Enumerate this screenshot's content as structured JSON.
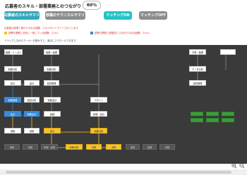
{
  "header": {
    "title": "応募者のスキル・部署業務とのつながり",
    "match_rate": "60%"
  },
  "tabs": [
    {
      "label": "応募者のスキルサマリー",
      "state": "active"
    },
    {
      "label": "部署のテクニカルサマリー",
      "state": "inactive"
    },
    {
      "label": "マッチングON",
      "state": "teal"
    },
    {
      "label": "マッチングOFF",
      "state": "inactive"
    }
  ],
  "legend": {
    "title": "応募者の経歴と関わりのある経験・スキルがハイライトされています",
    "items": [
      {
        "label": "部署の業務と完全に一致している経験・スキル",
        "color": "#f4c233"
      },
      {
        "label": "部署の業務と間接的につながりのある経験・スキル",
        "color": "#3a8bd8"
      }
    ]
  },
  "hint": "ドラッグしながらマーカーを動かすと、宝法にスクロールできます",
  "colors": {
    "accent": "#32a8bd",
    "match_on": "#21c4c6",
    "exact_match": "#f4c233",
    "indirect_match": "#3a8bd8",
    "canvas_bg": "#3a3a3a"
  },
  "graph": {
    "nodes": [
      {
        "id": "n1",
        "label": "経理・リーガル",
        "style": "white"
      },
      {
        "id": "n2",
        "label": "財務・経理",
        "style": "white"
      },
      {
        "id": "n3",
        "label": "財務分析",
        "style": "white"
      },
      {
        "id": "n4",
        "label": "財務分析",
        "style": "white"
      },
      {
        "id": "n5",
        "label": "予算・管理",
        "style": "white"
      },
      {
        "id": "n6",
        "label": "データ分析",
        "style": "white"
      },
      {
        "id": "n7",
        "label": "会計",
        "style": "white"
      },
      {
        "id": "n8",
        "label": "会計",
        "style": "white"
      },
      {
        "id": "n9",
        "label": "経営管理",
        "style": "white"
      },
      {
        "id": "n10",
        "label": "経営管理",
        "style": "white"
      },
      {
        "id": "n11",
        "label": "財務管理",
        "style": "blue"
      },
      {
        "id": "n12",
        "label": "会計",
        "style": "blue"
      },
      {
        "id": "n13",
        "label": "財務会計",
        "style": "blue"
      },
      {
        "id": "n14",
        "label": "経営分析",
        "style": "white"
      },
      {
        "id": "n15",
        "label": "デザイン",
        "style": "white"
      },
      {
        "id": "n16",
        "label": "財務会計",
        "style": "white"
      },
      {
        "id": "n17",
        "label": "経理",
        "style": "white"
      },
      {
        "id": "n18",
        "label": "財務・会計",
        "style": "white"
      },
      {
        "id": "n19",
        "label": "業務",
        "style": "white"
      },
      {
        "id": "n20",
        "label": "税務",
        "style": "white"
      },
      {
        "id": "n21",
        "label": "会計",
        "style": "yellow"
      },
      {
        "id": "n22",
        "label": "財務分析",
        "style": "yellow"
      },
      {
        "id": "n23",
        "label": "財務分析",
        "style": "yellow"
      },
      {
        "id": "n24",
        "label": "財務",
        "style": "yellow"
      },
      {
        "id": "n25",
        "label": "財務",
        "style": "dark"
      },
      {
        "id": "n26",
        "label": "財務",
        "style": "dark"
      },
      {
        "id": "n27",
        "label": "財務・経理",
        "style": "dark"
      },
      {
        "id": "n28",
        "label": "財務",
        "style": "dark"
      },
      {
        "id": "n29",
        "label": "決算",
        "style": "yellow"
      },
      {
        "id": "n30",
        "label": "決算",
        "style": "yellow"
      },
      {
        "id": "n31",
        "label": "税務",
        "style": "dark"
      },
      {
        "id": "n32",
        "label": "経理",
        "style": "dark"
      },
      {
        "id": "n33",
        "label": "",
        "style": "green"
      },
      {
        "id": "n34",
        "label": "",
        "style": "green"
      },
      {
        "id": "n35",
        "label": "",
        "style": "green"
      },
      {
        "id": "n36",
        "label": "",
        "style": "green"
      },
      {
        "id": "n37",
        "label": "",
        "style": "green"
      },
      {
        "id": "n38",
        "label": "",
        "style": "green"
      }
    ]
  },
  "toolbar": {
    "zoom_in_icon": "zoom-in-icon",
    "zoom_out_icon": "zoom-out-icon"
  }
}
